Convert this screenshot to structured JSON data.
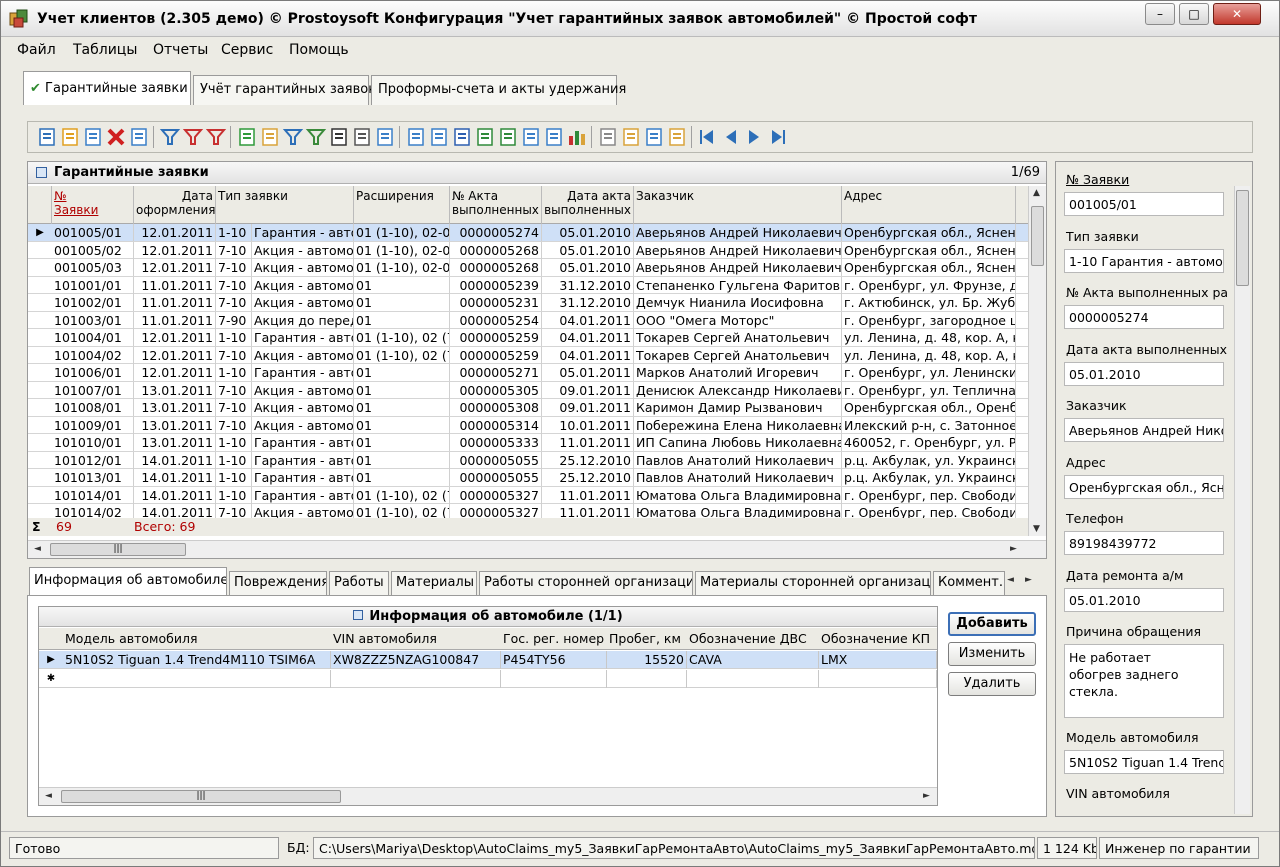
{
  "window": {
    "title": "Учет клиентов (2.305 демо) © Prostoysoft  Конфигурация \"Учет гарантийных заявок автомобилей\" © Простой софт"
  },
  "menu": [
    "Файл",
    "Таблицы",
    "Отчеты",
    "Сервис",
    "Помощь"
  ],
  "top_tabs": [
    {
      "label": "Гарантийные заявки",
      "active": true
    },
    {
      "label": "Учёт гарантийных заявок",
      "active": false
    },
    {
      "label": "Проформы-счета и акты удержания",
      "active": false
    }
  ],
  "main_panel": {
    "title": "Гарантийные заявки",
    "count": "1/69",
    "columns": [
      {
        "label": "№\nЗаявки"
      },
      {
        "label": "Дата\nоформления"
      },
      {
        "label": "Тип заявки"
      },
      {
        "label": "Расширения"
      },
      {
        "label": "№ Акта\nвыполненных"
      },
      {
        "label": "Дата акта\nвыполненных"
      },
      {
        "label": "Заказчик"
      },
      {
        "label": "Адрес"
      }
    ],
    "rows": [
      [
        "001005/01",
        "12.01.2011",
        "1-10",
        "Гарантия - авто",
        "01 (1-10), 02-0",
        "0000005274",
        "05.01.2010",
        "Аверьянов Андрей Николаевич",
        "Оренбургская обл., Яснен"
      ],
      [
        "001005/02",
        "12.01.2011",
        "7-10",
        "Акция - автомо",
        "01 (1-10), 02-0",
        "0000005268",
        "05.01.2010",
        "Аверьянов Андрей Николаевич",
        "Оренбургская обл., Яснен"
      ],
      [
        "001005/03",
        "12.01.2011",
        "7-10",
        "Акция - автомо",
        "01 (1-10), 02-0",
        "0000005268",
        "05.01.2010",
        "Аверьянов Андрей Николаевич",
        "Оренбургская обл., Яснен"
      ],
      [
        "101001/01",
        "11.01.2011",
        "7-10",
        "Акция - автомо",
        "01",
        "0000005239",
        "31.12.2010",
        "Степаненко Гульгена Фаритов",
        "г. Оренбург, ул. Фрунзе, д"
      ],
      [
        "101002/01",
        "11.01.2011",
        "7-10",
        "Акция - автомо",
        "01",
        "0000005231",
        "31.12.2010",
        "Демчук Нианила Иосифовна",
        "г. Актюбинск, ул. Бр. Жуба"
      ],
      [
        "101003/01",
        "11.01.2011",
        "7-90",
        "Акция до перед",
        "01",
        "0000005254",
        "04.01.2011",
        "ООО \"Омега Моторс\"",
        "г. Оренбург, загородное ш"
      ],
      [
        "101004/01",
        "12.01.2011",
        "1-10",
        "Гарантия - авто",
        "01 (1-10), 02 (7",
        "0000005259",
        "04.01.2011",
        "Токарев Сергей Анатольевич",
        "ул. Ленина, д. 48, кор. А, к"
      ],
      [
        "101004/02",
        "12.01.2011",
        "7-10",
        "Акция - автомо",
        "01 (1-10), 02 (7",
        "0000005259",
        "04.01.2011",
        "Токарев Сергей Анатольевич",
        "ул. Ленина, д. 48, кор. А, к"
      ],
      [
        "101006/01",
        "12.01.2011",
        "1-10",
        "Гарантия - авто",
        "01",
        "0000005271",
        "05.01.2011",
        "Марков Анатолий Игоревич",
        "г. Оренбург, ул. Ленинский р"
      ],
      [
        "101007/01",
        "13.01.2011",
        "7-10",
        "Акция - автомо",
        "01",
        "0000005305",
        "09.01.2011",
        "Денисюк Александр Николаевич",
        "г. Оренбург, ул. Тепличная"
      ],
      [
        "101008/01",
        "13.01.2011",
        "7-10",
        "Акция - автомо",
        "01",
        "0000005308",
        "09.01.2011",
        "Каримон Дамир Рызванович",
        "Оренбургская обл., Оренбу"
      ],
      [
        "101009/01",
        "13.01.2011",
        "7-10",
        "Акция - автомо",
        "01",
        "0000005314",
        "10.01.2011",
        "Побережина Елена Николаевна",
        "Илекский р-н, с. Затонное,"
      ],
      [
        "101010/01",
        "13.01.2011",
        "1-10",
        "Гарантия - авто",
        "01",
        "0000005333",
        "11.01.2011",
        "ИП Сапина Любовь Николаевна",
        "460052, г. Оренбург, ул. Ро"
      ],
      [
        "101012/01",
        "14.01.2011",
        "1-10",
        "Гарантия - авто",
        "01",
        "0000005055",
        "25.12.2010",
        "Павлов Анатолий Николаевич",
        "р.ц. Акбулак, ул. Украинск"
      ],
      [
        "101013/01",
        "14.01.2011",
        "1-10",
        "Гарантия - авто",
        "01",
        "0000005055",
        "25.12.2010",
        "Павлов Анатолий Николаевич",
        "р.ц. Акбулак, ул. Украинск"
      ],
      [
        "101014/01",
        "14.01.2011",
        "1-10",
        "Гарантия - авто",
        "01 (1-10), 02 (7",
        "0000005327",
        "11.01.2011",
        "Юматова Ольга Владимировна",
        "г. Оренбург, пер. Свободин"
      ],
      [
        "101014/02",
        "14.01.2011",
        "7-10",
        "Акция - автомо",
        "01 (1-10), 02 (7",
        "0000005327",
        "11.01.2011",
        "Юматова Ольга Владимировна",
        "г. Оренбург, пер. Свободин"
      ]
    ],
    "summary": {
      "count": "69",
      "total": "Всего: 69"
    }
  },
  "detail": {
    "fields": [
      {
        "label": "№ Заявки",
        "value": "001005/01",
        "underline": true
      },
      {
        "label": "Тип заявки",
        "value": "1-10   Гарантия - автомо"
      },
      {
        "label": "№ Акта выполненных ра",
        "value": "0000005274"
      },
      {
        "label": "Дата акта выполненных",
        "value": "05.01.2010"
      },
      {
        "label": "Заказчик",
        "value": "Аверьянов Андрей Никол"
      },
      {
        "label": "Адрес",
        "value": "Оренбургская обл., Ясн"
      },
      {
        "label": "Телефон",
        "value": "89198439772"
      },
      {
        "label": "Дата ремонта а/м",
        "value": "05.01.2010"
      }
    ],
    "reason_label": "Причина обращения",
    "reason_value": "Не работает обогрев заднего стекла.",
    "model_label": "Модель автомобиля",
    "model_value": "5N10S2 Tiguan 1.4 Trenc",
    "vin_label": "VIN автомобиля"
  },
  "bottom_tabs": [
    {
      "label": "Информация об автомобиле",
      "active": true
    },
    {
      "label": "Повреждения"
    },
    {
      "label": "Работы"
    },
    {
      "label": "Материалы"
    },
    {
      "label": "Работы сторонней организации"
    },
    {
      "label": "Материалы сторонней организации"
    },
    {
      "label": "Коммент..."
    }
  ],
  "car_info": {
    "title": "Информация об автомобиле (1/1)",
    "columns": [
      "Модель автомобиля",
      "VIN автомобиля",
      "Гос. рег. номер",
      "Пробег, км",
      "Обозначение ДВС",
      "Обозначение КП"
    ],
    "rows": [
      [
        "5N10S2 Tiguan 1.4 Trend4M110 TSIM6A",
        "XW8ZZZ5NZAG100847",
        "P454TY56",
        "15520",
        "CAVA",
        "LMX"
      ]
    ],
    "buttons": {
      "add": "Добавить",
      "edit": "Изменить",
      "delete": "Удалить"
    }
  },
  "status": {
    "left": "Готово",
    "db_label": "БД:",
    "db_path": "C:\\Users\\Mariya\\Desktop\\AutoClaims_my5_ЗаявкиГарРемонтаАвто\\AutoClaims_my5_ЗаявкиГарРемонтаАвто.mdb",
    "size": "1 124 Kb",
    "user": "Инженер по гарантии"
  }
}
